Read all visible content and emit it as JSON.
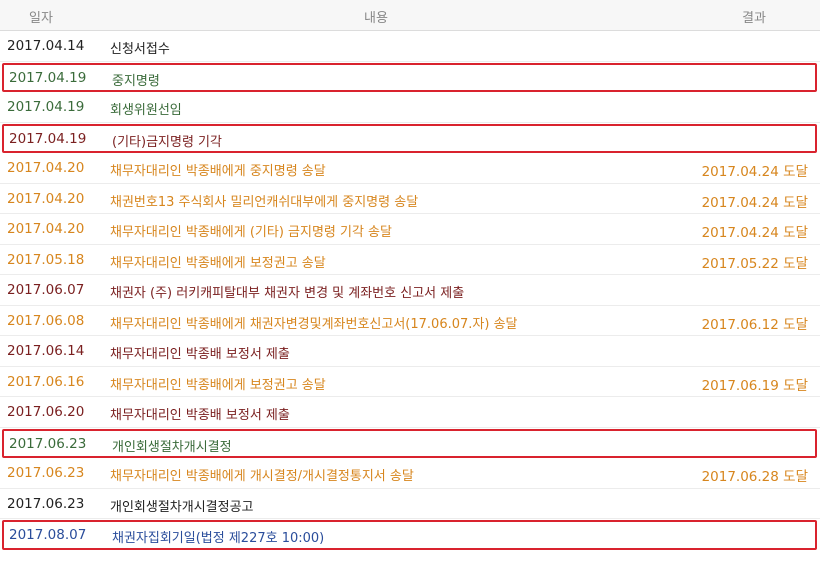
{
  "header": {
    "date": "일자",
    "content": "내용",
    "result": "결과"
  },
  "colors": {
    "black": "#222222",
    "green": "#3a6b3a",
    "orange": "#d7861e",
    "maroon": "#7a1f1f",
    "blue": "#2a4d9b",
    "highlight_border": "#d9232e"
  },
  "rows": [
    {
      "date": "2017.04.14",
      "content": "신청서접수",
      "result": "",
      "color": "black",
      "boxed": false
    },
    {
      "date": "2017.04.19",
      "content": "중지명령",
      "result": "",
      "color": "green",
      "boxed": true
    },
    {
      "date": "2017.04.19",
      "content": "회생위원선임",
      "result": "",
      "color": "green",
      "boxed": false
    },
    {
      "date": "2017.04.19",
      "content": "(기타)금지명령 기각",
      "result": "",
      "color": "maroon",
      "boxed": true
    },
    {
      "date": "2017.04.20",
      "content": "채무자대리인 박종배에게 중지명령 송달",
      "result": "2017.04.24 도달",
      "color": "orange",
      "boxed": false
    },
    {
      "date": "2017.04.20",
      "content": "채권번호13 주식회사 밀리언캐쉬대부에게 중지명령 송달",
      "result": "2017.04.24 도달",
      "color": "orange",
      "boxed": false
    },
    {
      "date": "2017.04.20",
      "content": "채무자대리인 박종배에게 (기타) 금지명령 기각 송달",
      "result": "2017.04.24 도달",
      "color": "orange",
      "boxed": false
    },
    {
      "date": "2017.05.18",
      "content": "채무자대리인 박종배에게 보정권고 송달",
      "result": "2017.05.22 도달",
      "color": "orange",
      "boxed": false
    },
    {
      "date": "2017.06.07",
      "content": "채권자 (주) 러키캐피탈대부 채권자 변경 및 계좌번호 신고서 제출",
      "result": "",
      "color": "maroon",
      "boxed": false
    },
    {
      "date": "2017.06.08",
      "content": "채무자대리인 박종배에게 채권자변경및계좌번호신고서(17.06.07.자) 송달",
      "result": "2017.06.12 도달",
      "color": "orange",
      "boxed": false
    },
    {
      "date": "2017.06.14",
      "content": "채무자대리인 박종배 보정서 제출",
      "result": "",
      "color": "maroon",
      "boxed": false
    },
    {
      "date": "2017.06.16",
      "content": "채무자대리인 박종배에게 보정권고 송달",
      "result": "2017.06.19 도달",
      "color": "orange",
      "boxed": false
    },
    {
      "date": "2017.06.20",
      "content": "채무자대리인 박종배 보정서 제출",
      "result": "",
      "color": "maroon",
      "boxed": false
    },
    {
      "date": "2017.06.23",
      "content": "개인회생절차개시결정",
      "result": "",
      "color": "green",
      "boxed": true
    },
    {
      "date": "2017.06.23",
      "content": "채무자대리인 박종배에게 개시결정/개시결정통지서 송달",
      "result": "2017.06.28 도달",
      "color": "orange",
      "boxed": false
    },
    {
      "date": "2017.06.23",
      "content": "개인회생절차개시결정공고",
      "result": "",
      "color": "black",
      "boxed": false
    },
    {
      "date": "2017.08.07",
      "content": "채권자집회기일(법정 제227호 10:00)",
      "result": "",
      "color": "blue",
      "boxed": true
    }
  ]
}
